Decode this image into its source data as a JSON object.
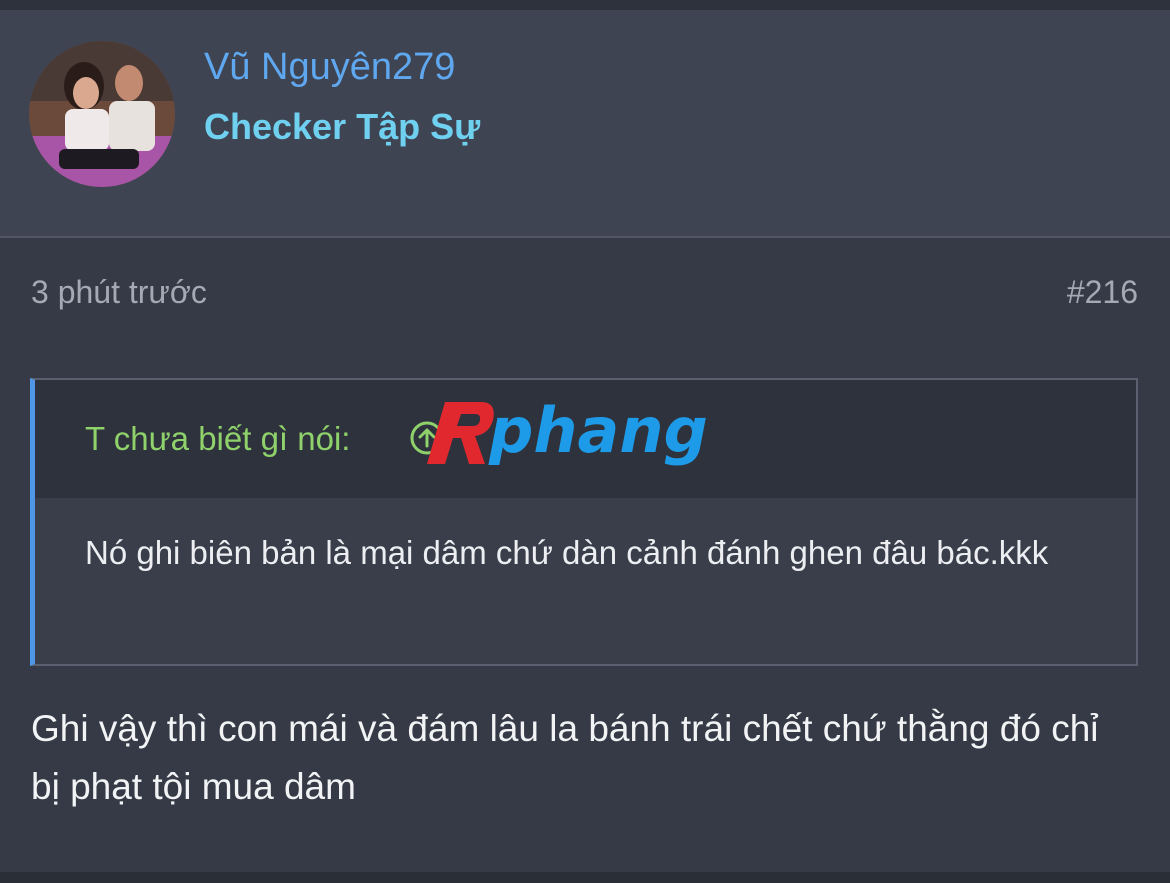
{
  "user": {
    "name": "Vũ Nguyên279",
    "title": "Checker Tập Sự"
  },
  "post": {
    "time": "3 phút trước",
    "number": "#216",
    "quote": {
      "author": "T chưa biết gì nói:",
      "text": "Nó ghi biên bản là mại dâm chứ dàn cảnh đánh ghen đâu bác.kkk"
    },
    "body": "Ghi vậy thì con mái và đám lâu la bánh trái chết chứ thằng đó chỉ bị phạt tội mua dâm"
  },
  "watermark": {
    "text": "phang"
  },
  "colors": {
    "username": "#5fa8f0",
    "usertitle": "#6fd0f0",
    "quote_author": "#8fd16a",
    "quote_border": "#4f97e6",
    "watermark_red": "#e0282e",
    "watermark_blue": "#1e9be8"
  },
  "icons": {
    "quote_jump": "arrow-up-circle-icon"
  }
}
